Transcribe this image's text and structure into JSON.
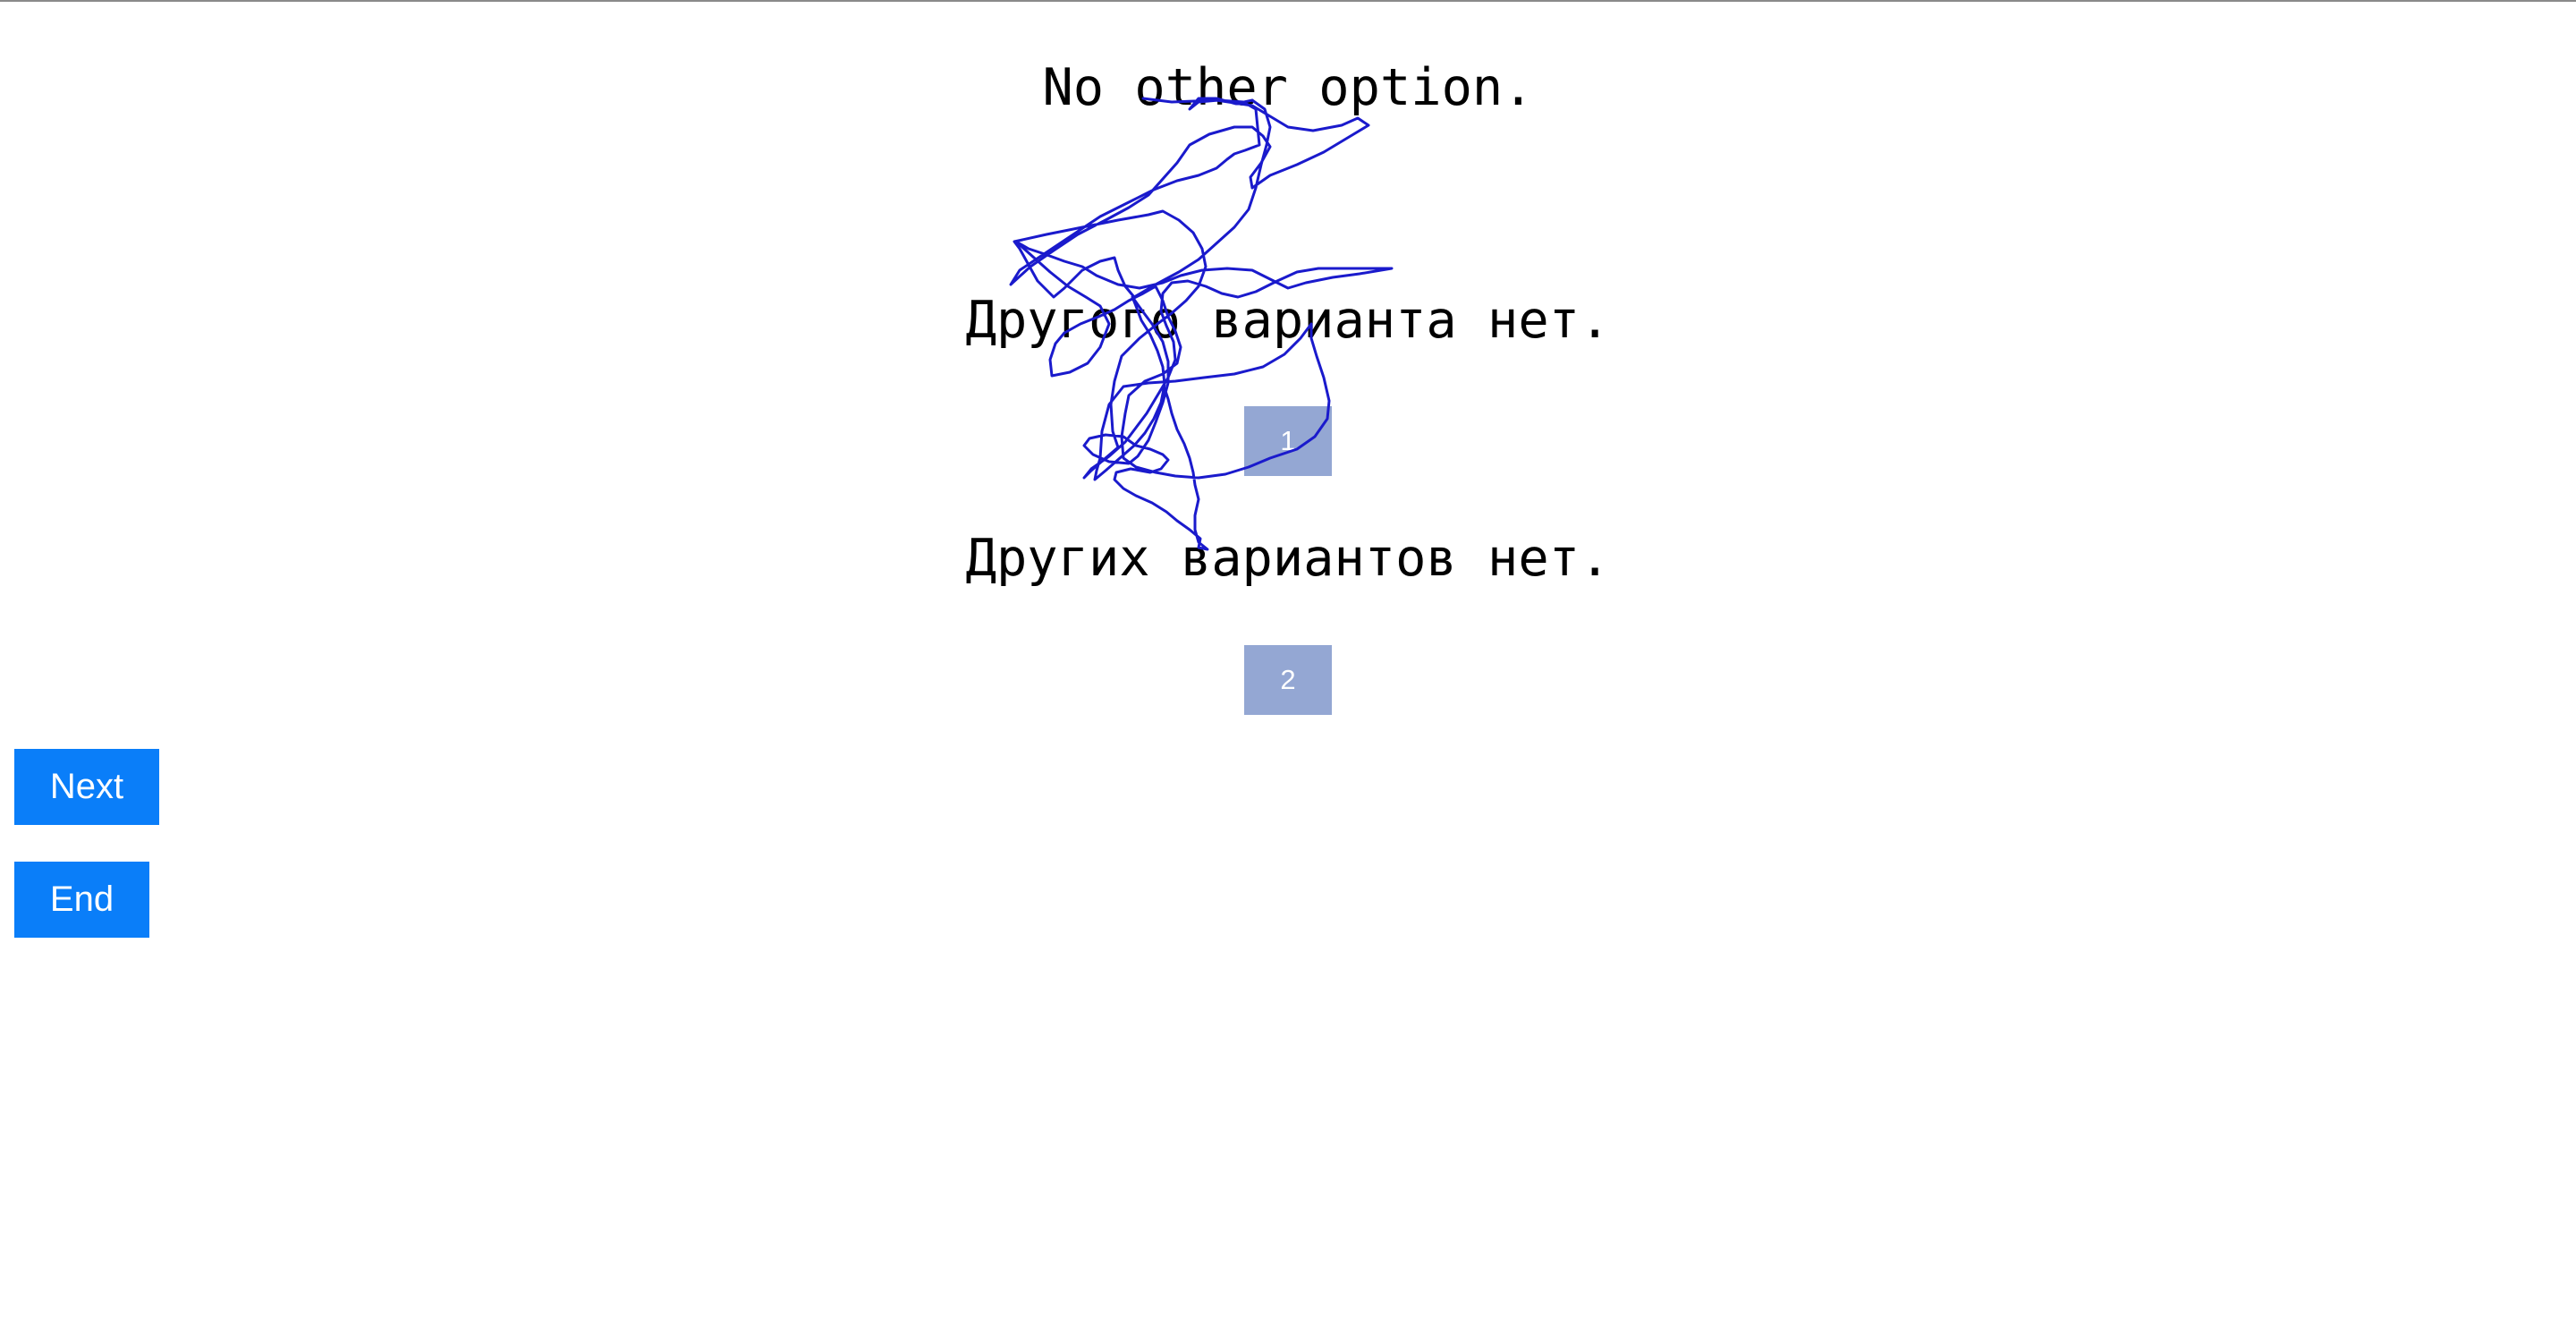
{
  "sentences": {
    "source": "No other option.",
    "option_1": "Другого варианта нет.",
    "option_2": "Других вариантов нет."
  },
  "choices": {
    "choice_1_label": "1",
    "choice_2_label": "2"
  },
  "nav": {
    "next_label": "Next",
    "end_label": "End"
  },
  "colors": {
    "choice_button": "#94a7d3",
    "nav_button": "#0a7ef9",
    "scribble_stroke": "#1a1acc"
  }
}
